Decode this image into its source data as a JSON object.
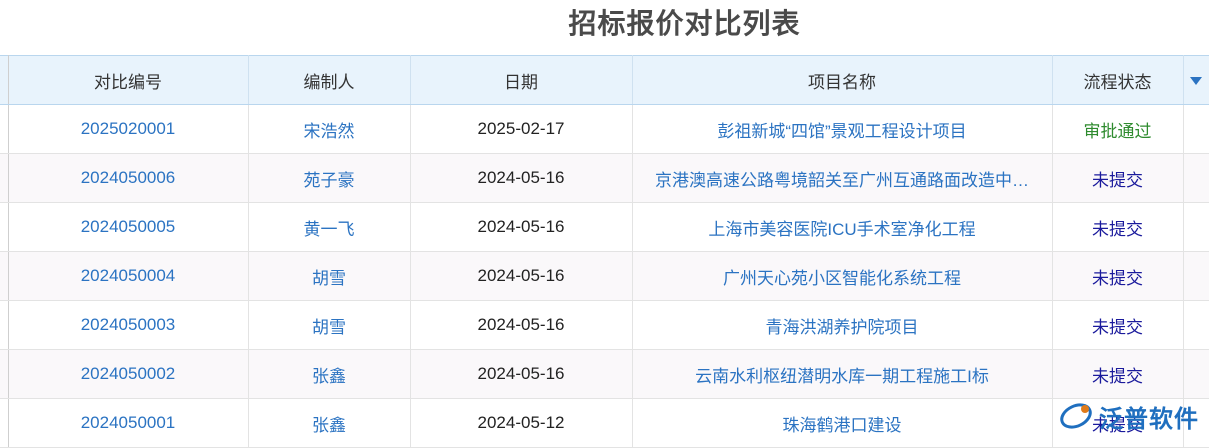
{
  "page": {
    "title": "招标报价对比列表"
  },
  "table": {
    "columns": [
      "对比编号",
      "编制人",
      "日期",
      "项目名称",
      "流程状态"
    ],
    "rows": [
      {
        "code": "2025020001",
        "person": "宋浩然",
        "date": "2025-02-17",
        "project": "彭祖新城“四馆”景观工程设计项目",
        "status": "审批通过"
      },
      {
        "code": "2024050006",
        "person": "苑子豪",
        "date": "2024-05-16",
        "project": "京港澳高速公路粤境韶关至广州互通路面改造中…",
        "status": "未提交"
      },
      {
        "code": "2024050005",
        "person": "黄一飞",
        "date": "2024-05-16",
        "project": "上海市美容医院ICU手术室净化工程",
        "status": "未提交"
      },
      {
        "code": "2024050004",
        "person": "胡雪",
        "date": "2024-05-16",
        "project": "广州天心苑小区智能化系统工程",
        "status": "未提交"
      },
      {
        "code": "2024050003",
        "person": "胡雪",
        "date": "2024-05-16",
        "project": "青海洪湖养护院项目",
        "status": "未提交"
      },
      {
        "code": "2024050002",
        "person": "张鑫",
        "date": "2024-05-16",
        "project": "云南水利枢纽潜明水库一期工程施工I标",
        "status": "未提交"
      },
      {
        "code": "2024050001",
        "person": "张鑫",
        "date": "2024-05-12",
        "project": "珠海鹤港口建设",
        "status": "未提交"
      }
    ]
  },
  "logo": {
    "text": "泛普软件"
  },
  "colors": {
    "approved": "#2e8b2e",
    "pending": "#1a1a9c",
    "link": "#2b73c2",
    "header_bg": "#e8f3fc",
    "status_header": "#e07b1a"
  }
}
